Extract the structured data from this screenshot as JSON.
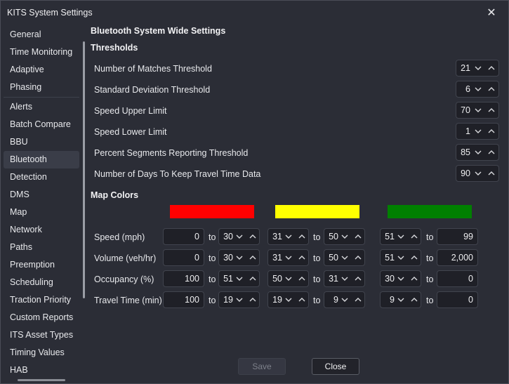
{
  "window": {
    "title": "KITS System Settings"
  },
  "sidebar": {
    "items": [
      "General",
      "Time Monitoring",
      "Adaptive",
      "Phasing",
      "Alerts",
      "Batch Compare",
      "BBU",
      "Bluetooth",
      "Detection",
      "DMS",
      "Map",
      "Network",
      "Paths",
      "Preemption",
      "Scheduling",
      "Traction Priority",
      "Custom Reports",
      "ITS Asset Types",
      "Timing Values",
      "HAB"
    ],
    "active": "Bluetooth"
  },
  "header": {
    "title": "Bluetooth System Wide Settings"
  },
  "thresholds": {
    "heading": "Thresholds",
    "rows": [
      {
        "label": "Number of Matches Threshold",
        "value": "21"
      },
      {
        "label": "Standard Deviation Threshold",
        "value": "6"
      },
      {
        "label": "Speed Upper Limit",
        "value": "70"
      },
      {
        "label": "Speed Lower Limit",
        "value": "1"
      },
      {
        "label": "Percent Segments Reporting Threshold",
        "value": "85"
      },
      {
        "label": "Number of Days To Keep Travel Time Data",
        "value": "90"
      }
    ]
  },
  "map_colors": {
    "heading": "Map Colors",
    "swatches": [
      "#ff0000",
      "#ffff00",
      "#008000"
    ],
    "to_label": "to",
    "rows": [
      {
        "label": "Speed (mph)",
        "values": [
          "0",
          "30",
          "31",
          "50",
          "51",
          "99"
        ]
      },
      {
        "label": "Volume (veh/hr)",
        "values": [
          "0",
          "30",
          "31",
          "50",
          "51",
          "2,000"
        ]
      },
      {
        "label": "Occupancy (%)",
        "values": [
          "100",
          "51",
          "50",
          "31",
          "30",
          "0"
        ]
      },
      {
        "label": "Travel Time (min)",
        "values": [
          "100",
          "19",
          "19",
          "9",
          "9",
          "0"
        ]
      }
    ]
  },
  "footer": {
    "save_label": "Save",
    "close_label": "Close"
  }
}
